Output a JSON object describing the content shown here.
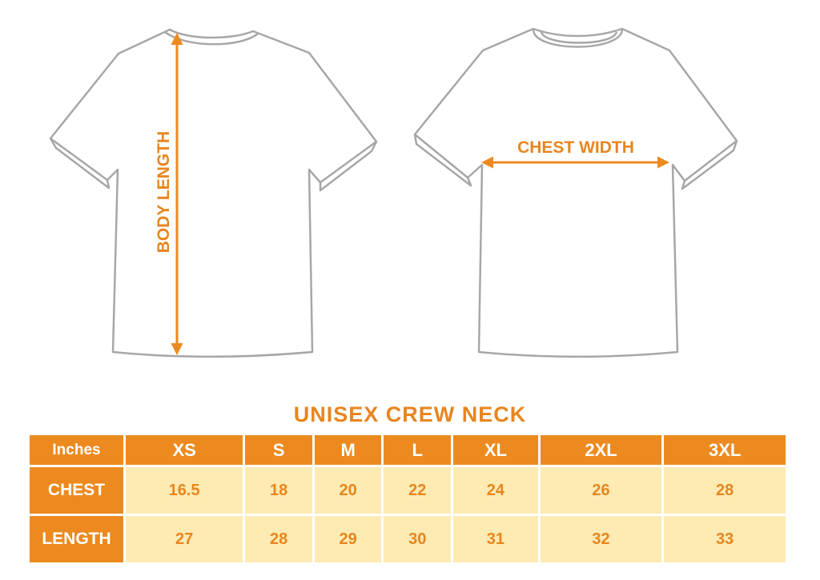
{
  "diagram": {
    "back_label": "BODY LENGTH",
    "front_label": "CHEST WIDTH"
  },
  "table": {
    "title": "UNISEX CREW NECK",
    "unit": "Inches",
    "sizes": [
      "XS",
      "S",
      "M",
      "L",
      "XL",
      "2XL",
      "3XL"
    ],
    "rows": [
      {
        "label": "CHEST",
        "values": [
          "16.5",
          "18",
          "20",
          "22",
          "24",
          "26",
          "28"
        ]
      },
      {
        "label": "LENGTH",
        "values": [
          "27",
          "28",
          "29",
          "30",
          "31",
          "32",
          "33"
        ]
      }
    ]
  },
  "colors": {
    "accent": "#ec8a1f",
    "cell_fill": "#fdebb3",
    "outline": "#a7a7a7"
  }
}
